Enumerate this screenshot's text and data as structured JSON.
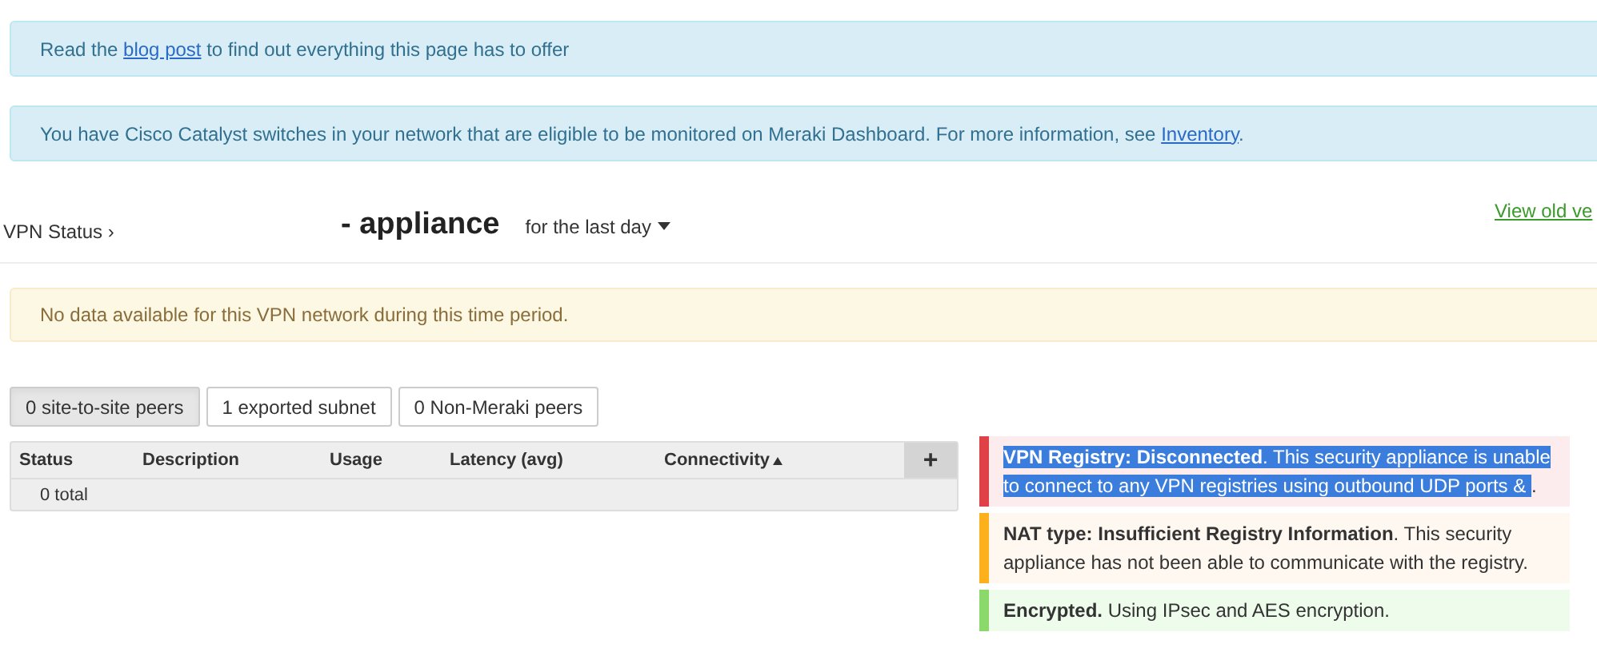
{
  "banners": [
    {
      "kind": "info",
      "before": "Read the ",
      "link": "blog post",
      "after": " to find out everything this page has to offer"
    },
    {
      "kind": "info",
      "before": "You have Cisco Catalyst switches in your network that are eligible to be monitored on Meraki Dashboard. For more information, see ",
      "link": "Inventory",
      "after": "."
    }
  ],
  "header": {
    "breadcrumb": "VPN Status ›",
    "title": "- appliance",
    "timespan": "for the last day",
    "old_view_link": "View old ve"
  },
  "notice": {
    "kind": "warning",
    "text": "No data available for this VPN network during this time period."
  },
  "tabs": [
    {
      "label": "0 site-to-site peers",
      "selected": true
    },
    {
      "label": "1 exported subnet",
      "selected": false
    },
    {
      "label": "0 Non-Meraki peers",
      "selected": false
    }
  ],
  "table": {
    "columns": [
      {
        "label": "Status",
        "sorted": false
      },
      {
        "label": "Description",
        "sorted": false
      },
      {
        "label": "Usage",
        "sorted": false
      },
      {
        "label": "Latency (avg)",
        "sorted": false
      },
      {
        "label": "Connectivity",
        "sorted": true
      }
    ],
    "add_button": "+",
    "footer": "0 total"
  },
  "statuses": [
    {
      "kind": "error",
      "bold": "VPN Registry: Disconnected",
      "text": ". This security appliance is unable to connect to any VPN registries using outbound UDP ports & ",
      "tail": ".",
      "highlighted": true
    },
    {
      "kind": "warning",
      "bold": "NAT type: Insufficient Registry Information",
      "text": ". This security appliance has not been able to communicate with the registry.",
      "highlighted": false
    },
    {
      "kind": "success",
      "bold": "Encrypted.",
      "text": " Using IPsec and AES encryption.",
      "highlighted": false
    }
  ]
}
